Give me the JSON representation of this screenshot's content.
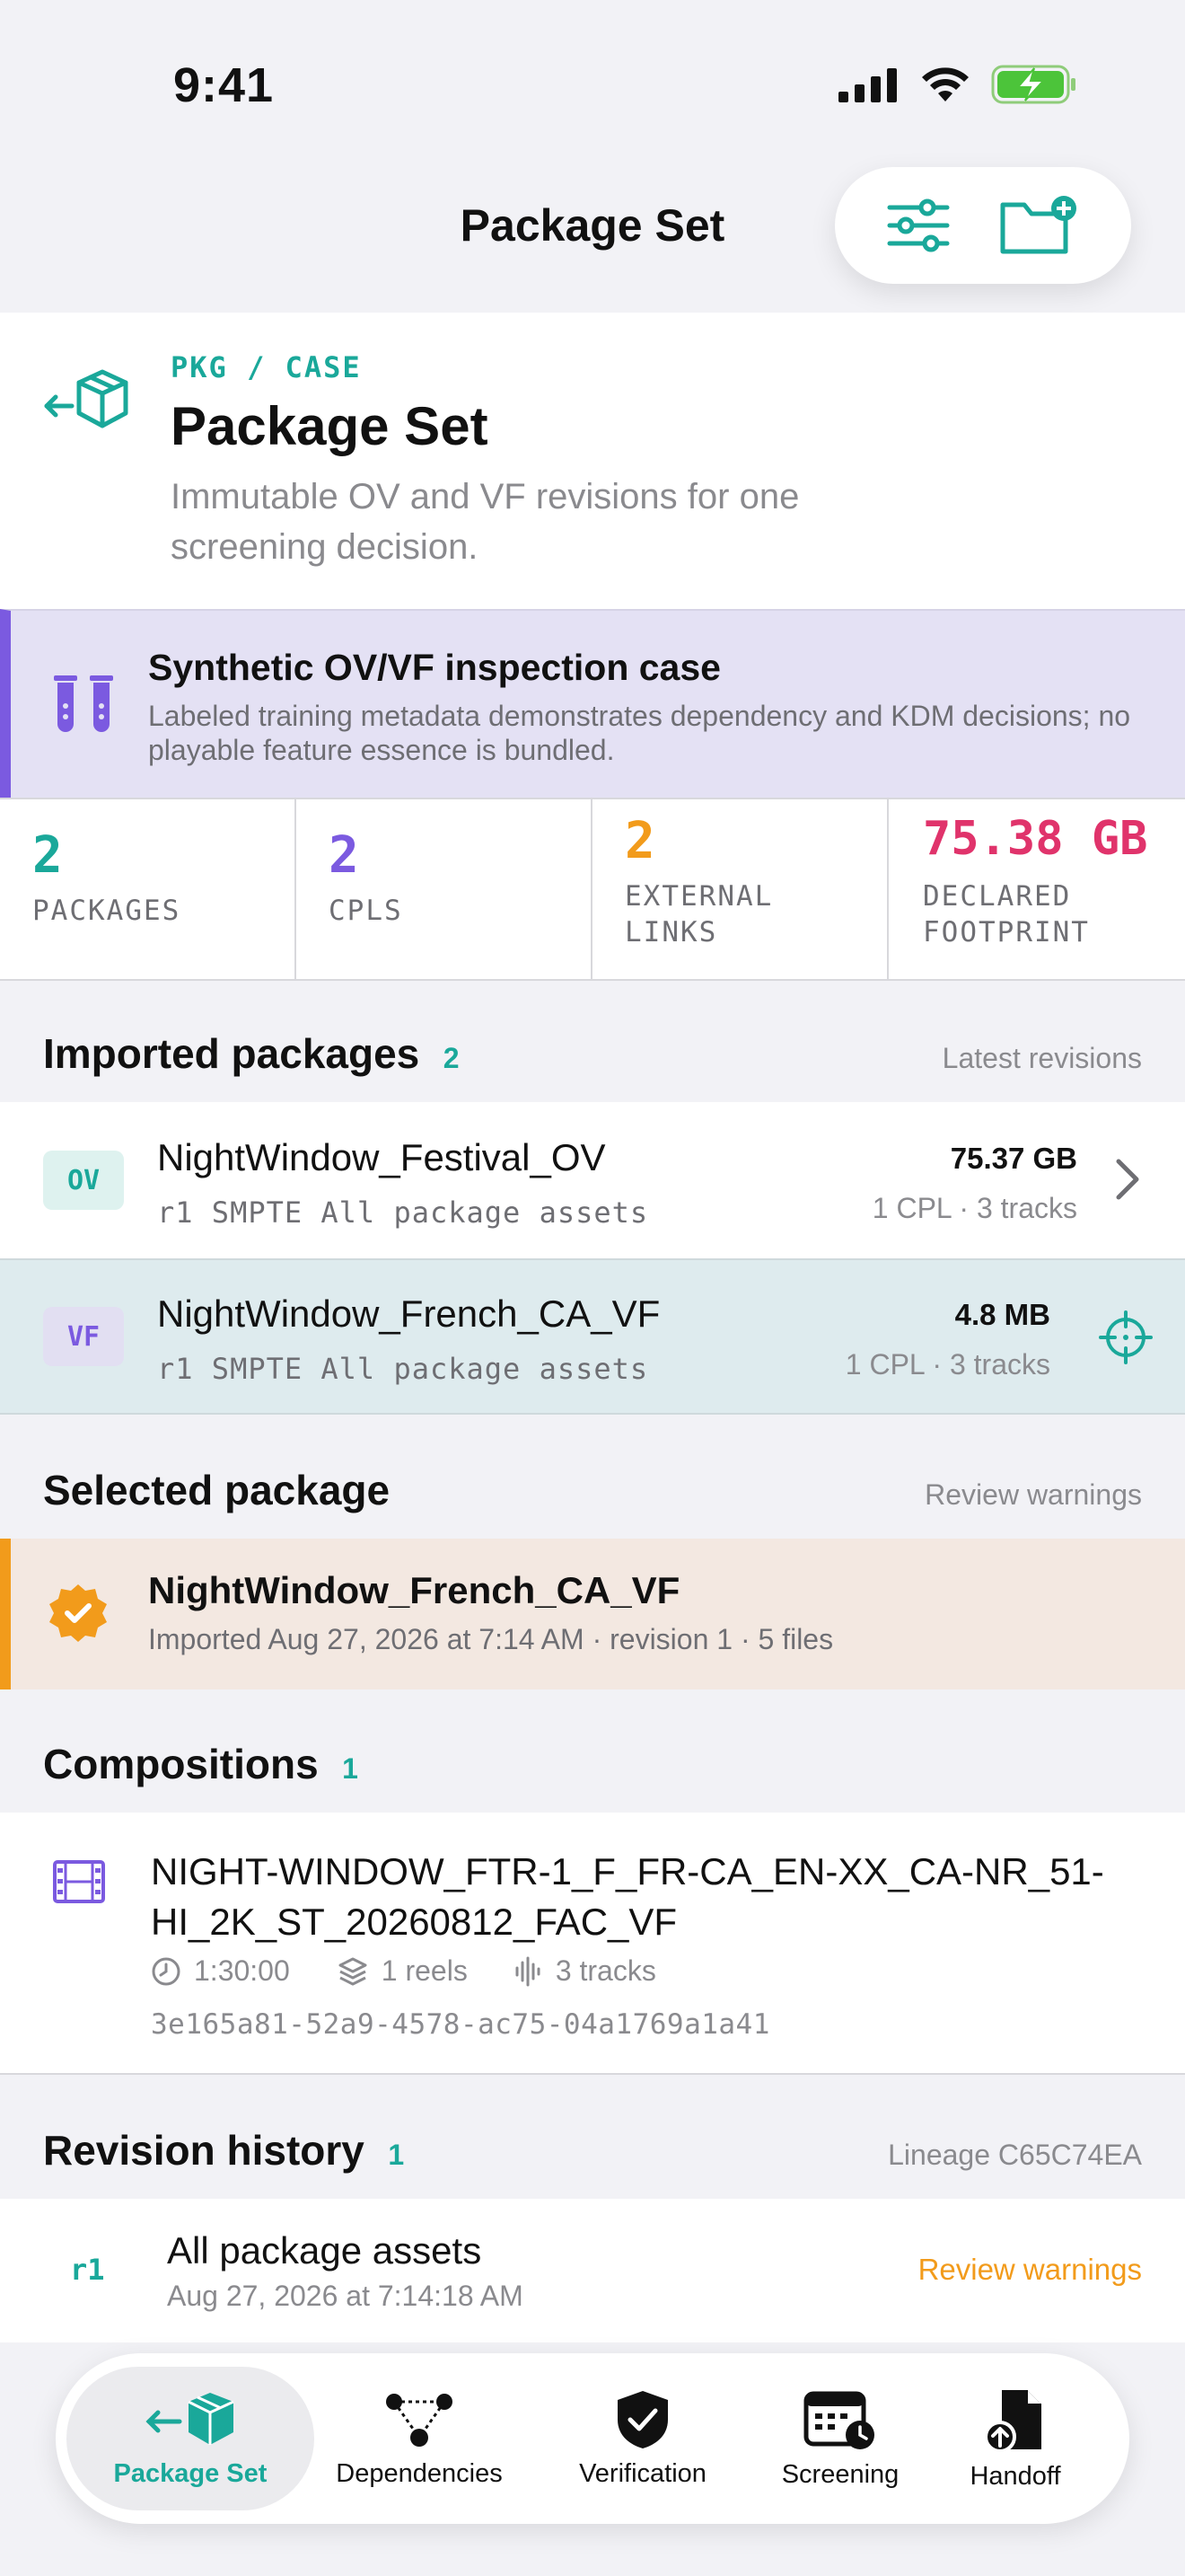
{
  "status_bar": {
    "time": "9:41"
  },
  "nav": {
    "title": "Package Set"
  },
  "header": {
    "eyebrow": "PKG / CASE",
    "title": "Package Set",
    "subtitle": "Immutable OV and VF revisions for one screening decision."
  },
  "banner": {
    "title": "Synthetic OV/VF inspection case",
    "subtitle": "Labeled training metadata demonstrates dependency and KDM decisions; no playable feature essence is bundled."
  },
  "stats": [
    {
      "value": "2",
      "label": "PACKAGES",
      "color": "#1aa89a"
    },
    {
      "value": "2",
      "label": "CPLS",
      "color": "#7b5ae0"
    },
    {
      "value": "2",
      "label": "EXTERNAL LINKS",
      "color": "#f29b1b"
    },
    {
      "value": "75.38 GB",
      "label": "DECLARED FOOTPRINT",
      "color": "#e0336b"
    }
  ],
  "imported": {
    "title": "Imported packages",
    "count": "2",
    "aside": "Latest revisions",
    "packages": [
      {
        "badge": "OV",
        "name": "NightWindow_Festival_OV",
        "meta": "r1 SMPTE All package assets",
        "size": "75.37 GB",
        "counts": "1 CPL · 3 tracks",
        "action_icon": "chevron-right-icon"
      },
      {
        "badge": "VF",
        "name": "NightWindow_French_CA_VF",
        "meta": "r1 SMPTE All package assets",
        "size": "4.8 MB",
        "counts": "1 CPL · 3 tracks",
        "action_icon": "crosshair-icon"
      }
    ]
  },
  "selected": {
    "title": "Selected package",
    "aside": "Review warnings",
    "name": "NightWindow_French_CA_VF",
    "meta": "Imported Aug 27, 2026 at 7:14 AM · revision 1 · 5 files"
  },
  "compositions": {
    "title": "Compositions",
    "count": "1",
    "item": {
      "title": "NIGHT-WINDOW_FTR-1_F_FR-CA_EN-XX_CA-NR_51-HI_2K_ST_20260812_FAC_VF",
      "duration": "1:30:00",
      "reels": "1 reels",
      "tracks": "3 tracks",
      "uuid": "3e165a81-52a9-4578-ac75-04a1769a1a41"
    }
  },
  "revisions": {
    "title": "Revision history",
    "count": "1",
    "aside": "Lineage C65C74EA",
    "item": {
      "tag": "r1",
      "title": "All package assets",
      "date": "Aug 27, 2026 at 7:14:18 AM",
      "status": "Review warnings"
    }
  },
  "tabs": [
    {
      "label": "Package Set",
      "icon": "package-icon",
      "active": true
    },
    {
      "label": "Dependencies",
      "icon": "dependencies-icon",
      "active": false
    },
    {
      "label": "Verification",
      "icon": "shield-check-icon",
      "active": false
    },
    {
      "label": "Screening",
      "icon": "calendar-clock-icon",
      "active": false
    },
    {
      "label": "Handoff",
      "icon": "document-upload-icon",
      "active": false
    }
  ],
  "colors": {
    "teal": "#1aa89a",
    "purple": "#7b5ae0",
    "orange": "#f29b1b",
    "pink": "#e0336b"
  }
}
